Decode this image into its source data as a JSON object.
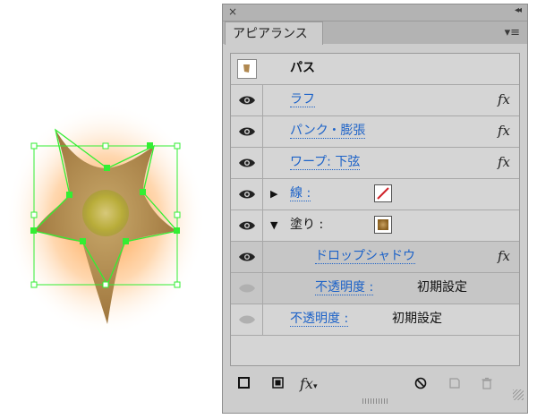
{
  "panel": {
    "tab_label": "アピアランス",
    "close_glyph": "×",
    "collapse_glyph": "◂◂",
    "menu_glyph": "▾≡"
  },
  "rows": {
    "path_label": "パス",
    "rough_label": "ラフ",
    "pucker_label": "パンク・膨張",
    "warp_label": "ワープ: 下弦",
    "stroke_label": "線 :",
    "fill_label": "塗り :",
    "dropshadow_label": "ドロップシャドウ",
    "opacity_fill_label": "不透明度 :",
    "opacity_fill_value": "初期設定",
    "opacity_label": "不透明度 :",
    "opacity_value": "初期設定",
    "fx_glyph": "fx"
  },
  "toolbar": {
    "fx_label": "fx",
    "fx_caret": "▾"
  },
  "colors": {
    "link": "#1c62c8",
    "selection_green": "#33ff33",
    "glow_orange": "#ff9a3c",
    "star_fill": "#b08850"
  }
}
